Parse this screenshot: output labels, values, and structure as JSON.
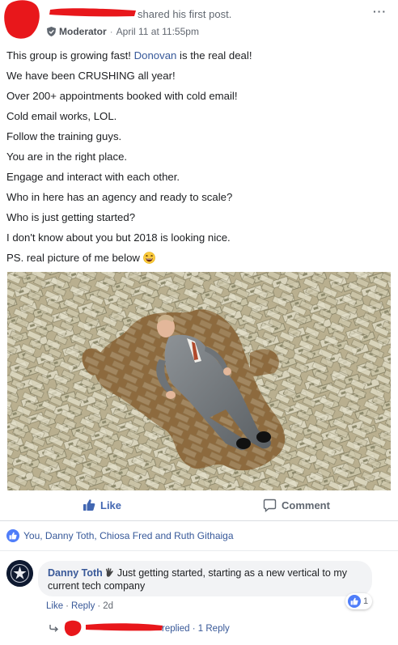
{
  "header": {
    "shared_text": "shared his first post.",
    "role": "Moderator",
    "separator": "·",
    "timestamp": "April 11 at 11:55pm",
    "more_icon": "more-dots-icon",
    "more_glyph": "···"
  },
  "post": {
    "lines": [
      {
        "before": "This group is growing fast! ",
        "link": "Donovan",
        "after": " is the real deal!"
      },
      "We have been CRUSHING all year!",
      "Over 200+ appointments booked with cold email!",
      "Cold email works, LOL.",
      "Follow the training guys.",
      "You are in the right place.",
      "Engage and interact with each other.",
      "Who in here has an agency and ready to scale?",
      "Who is just getting started?",
      "I don't know about you but 2018 is looking nice.",
      "PS. real picture of me below"
    ],
    "emoji": "laughing-emoji"
  },
  "actions": {
    "like_label": "Like",
    "comment_label": "Comment"
  },
  "reactions": {
    "text": "You, Danny Toth, Chiosa Fred and Ruth Githaiga"
  },
  "comment": {
    "author": "Danny Toth",
    "text": "Just getting started, starting as a new vertical to my current tech company",
    "like_label": "Like",
    "reply_label": "Reply",
    "separator": "·",
    "age": "2d",
    "reaction_count": "1"
  },
  "replies": {
    "replied_text": "replied",
    "separator": "·",
    "count_label": "1 Reply"
  },
  "colors": {
    "link": "#365899",
    "like_blue": "#4267b2",
    "redaction": "#e8171b",
    "bubble": "#f2f3f5"
  }
}
